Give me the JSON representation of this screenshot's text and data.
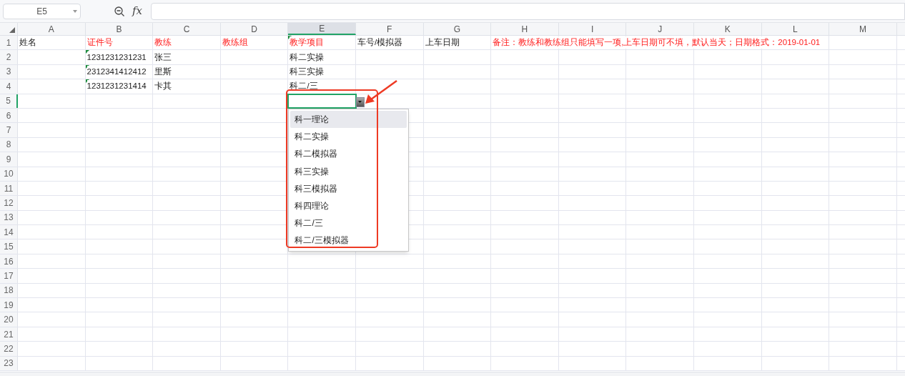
{
  "toolbar": {
    "name_box": "E5",
    "function_label": "fx"
  },
  "columns": [
    {
      "label": "A",
      "selected": false
    },
    {
      "label": "B",
      "selected": false
    },
    {
      "label": "C",
      "selected": false
    },
    {
      "label": "D",
      "selected": false
    },
    {
      "label": "E",
      "selected": true
    },
    {
      "label": "F",
      "selected": false
    },
    {
      "label": "G",
      "selected": false
    },
    {
      "label": "H",
      "selected": false
    },
    {
      "label": "I",
      "selected": false
    },
    {
      "label": "J",
      "selected": false
    },
    {
      "label": "K",
      "selected": false
    },
    {
      "label": "L",
      "selected": false
    },
    {
      "label": "M",
      "selected": false
    }
  ],
  "rows": [
    {
      "label": "1",
      "selected": false,
      "cells": [
        {
          "text": "姓名",
          "required": false,
          "flagged": false
        },
        {
          "text": "证件号",
          "required": true,
          "flagged": false
        },
        {
          "text": "教练",
          "required": true,
          "flagged": false
        },
        {
          "text": "教练组",
          "required": true,
          "flagged": false
        },
        {
          "text": "教学项目",
          "required": true,
          "flagged": true
        },
        {
          "text": "车号/模拟器",
          "required": false,
          "flagged": false
        },
        {
          "text": "上车日期",
          "required": false,
          "flagged": false
        },
        {
          "text": "备注：教练和教练组只能填写一项,上车日期可不填，默认当天；日期格式：2019-01-01",
          "required": true,
          "flagged": false
        }
      ]
    },
    {
      "label": "2",
      "selected": false,
      "cells": [
        null,
        {
          "text": "1231231231231",
          "required": false,
          "flagged": true
        },
        {
          "text": "张三",
          "required": false,
          "flagged": false
        },
        null,
        {
          "text": "科二实操",
          "required": false,
          "flagged": false
        }
      ]
    },
    {
      "label": "3",
      "selected": false,
      "cells": [
        null,
        {
          "text": "2312341412412",
          "required": false,
          "flagged": true
        },
        {
          "text": "里斯",
          "required": false,
          "flagged": false
        },
        null,
        {
          "text": "科三实操",
          "required": false,
          "flagged": false
        }
      ]
    },
    {
      "label": "4",
      "selected": false,
      "cells": [
        null,
        {
          "text": "1231231231414",
          "required": false,
          "flagged": true
        },
        {
          "text": "卡其",
          "required": false,
          "flagged": false
        },
        null,
        {
          "text": "科二/三",
          "required": false,
          "flagged": false
        }
      ]
    },
    {
      "label": "5",
      "selected": true,
      "cells": []
    },
    {
      "label": "6",
      "selected": false,
      "cells": []
    },
    {
      "label": "7",
      "selected": false,
      "cells": []
    },
    {
      "label": "8",
      "selected": false,
      "cells": []
    },
    {
      "label": "9",
      "selected": false,
      "cells": []
    },
    {
      "label": "10",
      "selected": false,
      "cells": []
    },
    {
      "label": "11",
      "selected": false,
      "cells": []
    },
    {
      "label": "12",
      "selected": false,
      "cells": []
    },
    {
      "label": "13",
      "selected": false,
      "cells": []
    },
    {
      "label": "14",
      "selected": false,
      "cells": []
    },
    {
      "label": "15",
      "selected": false,
      "cells": []
    },
    {
      "label": "16",
      "selected": false,
      "cells": []
    },
    {
      "label": "17",
      "selected": false,
      "cells": []
    },
    {
      "label": "18",
      "selected": false,
      "cells": []
    },
    {
      "label": "19",
      "selected": false,
      "cells": []
    },
    {
      "label": "20",
      "selected": false,
      "cells": []
    },
    {
      "label": "21",
      "selected": false,
      "cells": []
    },
    {
      "label": "22",
      "selected": false,
      "cells": []
    },
    {
      "label": "23",
      "selected": false,
      "cells": []
    }
  ],
  "dropdown": {
    "options": [
      {
        "label": "科一理论",
        "selected": true
      },
      {
        "label": "科二实操",
        "selected": false
      },
      {
        "label": "科二模拟器",
        "selected": false
      },
      {
        "label": "科三实操",
        "selected": false
      },
      {
        "label": "科三模拟器",
        "selected": false
      },
      {
        "label": "科四理论",
        "selected": false
      },
      {
        "label": "科二/三",
        "selected": false
      },
      {
        "label": "科二/三模拟器",
        "selected": false
      }
    ]
  }
}
